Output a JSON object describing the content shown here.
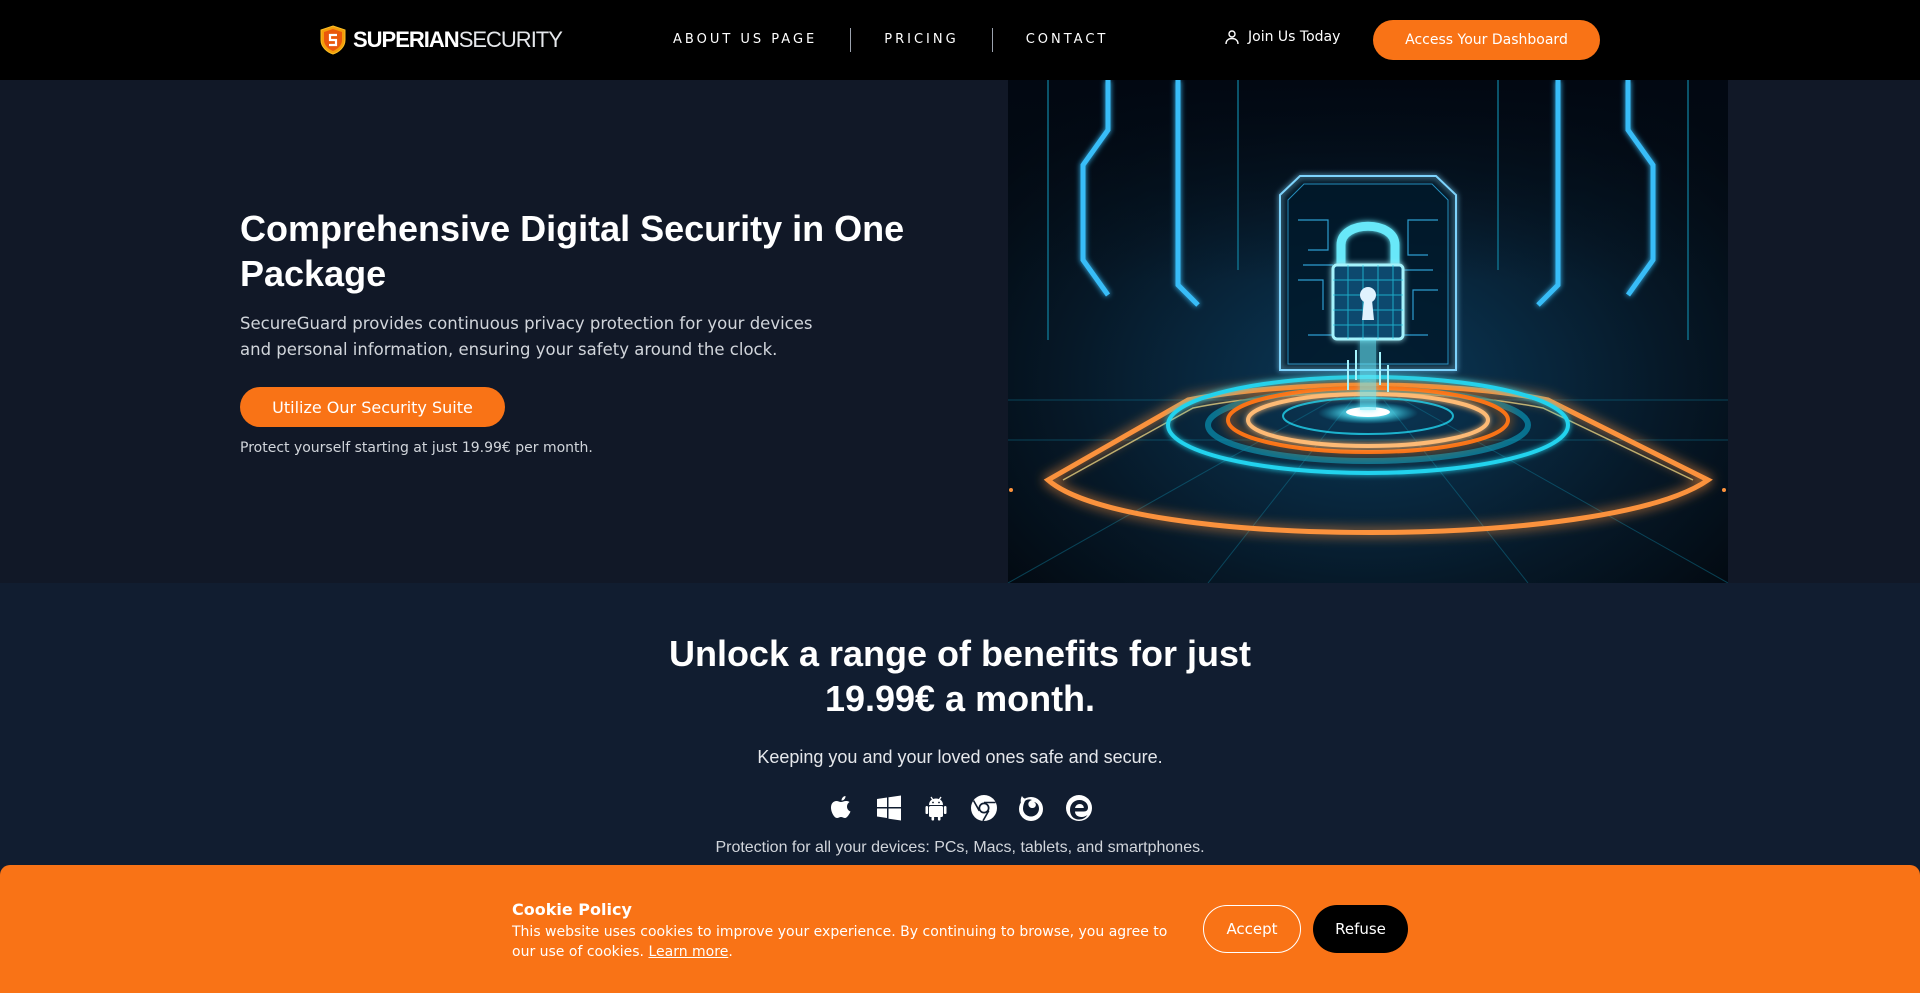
{
  "nav": {
    "logo_bold": "SUPERIAN",
    "logo_light": "SECURITY",
    "links": [
      "ABOUT US PAGE",
      "PRICING",
      "CONTACT"
    ],
    "join_label": "Join Us Today",
    "dashboard_label": "Access Your Dashboard"
  },
  "hero": {
    "title": "Comprehensive Digital Security in One Package",
    "description": "SecureGuard provides continuous privacy protection for your devices and personal information, ensuring your safety around the clock.",
    "cta_label": "Utilize Our Security Suite",
    "note": "Protect yourself starting at just 19.99€ per month."
  },
  "benefits": {
    "title": "Unlock a range of benefits for just 19.99€ a month.",
    "subtitle": "Keeping you and your loved ones safe and secure.",
    "platforms": [
      "apple-icon",
      "windows-icon",
      "android-icon",
      "chrome-icon",
      "firefox-icon",
      "edge-icon"
    ],
    "devices_text": "Protection for all your devices: PCs, Macs, tablets, and smartphones."
  },
  "cookie": {
    "title": "Cookie Policy",
    "text": "This website uses cookies to improve your experience. By continuing to browse, you agree to our use of cookies.",
    "learn_more": "Learn more",
    "accept_label": "Accept",
    "refuse_label": "Refuse"
  },
  "colors": {
    "accent": "#f97316",
    "nav_bg": "#000000",
    "hero_bg": "#111827",
    "benefits_bg": "#111d30",
    "neon_cyan": "#22d3ee"
  }
}
